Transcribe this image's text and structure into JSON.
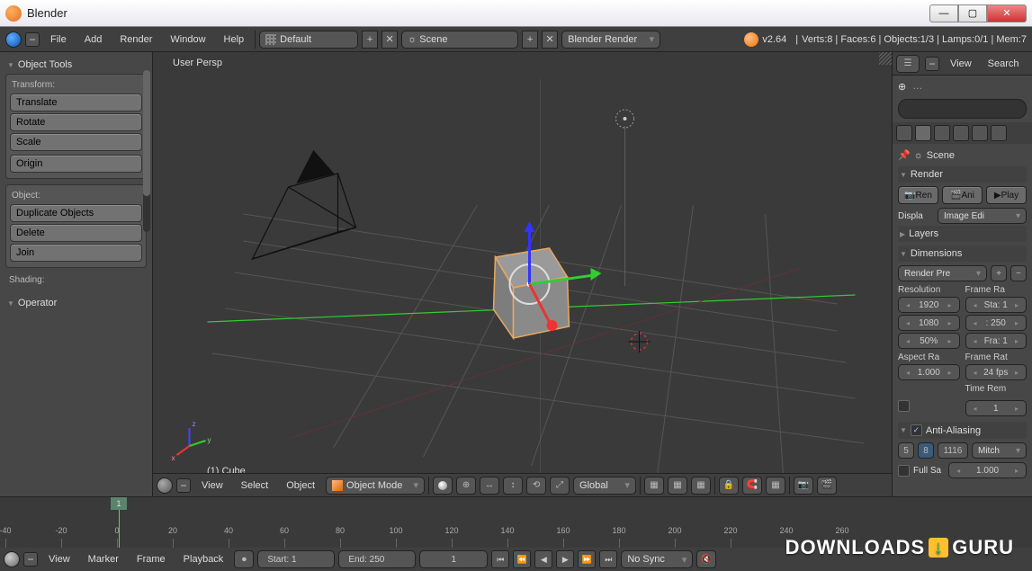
{
  "window": {
    "title": "Blender"
  },
  "topbar": {
    "menus": [
      "File",
      "Add",
      "Render",
      "Window",
      "Help"
    ],
    "layout_preset": "Default",
    "scene_name": "Scene",
    "engine": "Blender Render",
    "version": "v2.64",
    "stats": "Verts:8 | Faces:6 | Objects:1/3 | Lamps:0/1 | Mem:7"
  },
  "tools": {
    "header": "Object Tools",
    "transform_label": "Transform:",
    "translate": "Translate",
    "rotate": "Rotate",
    "scale": "Scale",
    "origin": "Origin",
    "object_label": "Object:",
    "duplicate": "Duplicate Objects",
    "delete": "Delete",
    "join": "Join",
    "shading_label": "Shading:",
    "operator": "Operator"
  },
  "viewport": {
    "persp_label": "User Persp",
    "active_object": "(1) Cube",
    "bar": {
      "view": "View",
      "select": "Select",
      "object": "Object",
      "mode": "Object Mode",
      "orientation": "Global"
    }
  },
  "outliner": {
    "view": "View",
    "search": "Search",
    "scene_name": "Scene"
  },
  "properties": {
    "render_header": "Render",
    "render_btn": "Ren",
    "anim_btn": "Ani",
    "play_btn": "Play",
    "display_label": "Displa",
    "display_value": "Image Edi",
    "layers_header": "Layers",
    "dimensions_header": "Dimensions",
    "preset": "Render Pre",
    "resolution_label": "Resolution",
    "framerange_label": "Frame Ra",
    "res_x": "1920",
    "res_y": "1080",
    "res_pct": "50%",
    "frame_start": "Sta: 1",
    "frame_end": ": 250",
    "frame_step": "Fra: 1",
    "aspect_label": "Aspect Ra",
    "framerate_label": "Frame Rat",
    "aspect_val": "1.000",
    "fps": "24 fps",
    "timeremap_label": "Time Rem",
    "timeremap_val": "1",
    "aa_header": "Anti-Aliasing",
    "aa_5": "5",
    "aa_8": "8",
    "aa_1116": "1116",
    "aa_filter": "Mitch",
    "fullsample": "Full Sa",
    "fullsample_val": "1.000"
  },
  "timeline": {
    "menus": [
      "View",
      "Marker",
      "Frame",
      "Playback"
    ],
    "start_label": "Start:",
    "start": "1",
    "end_label": "End:",
    "end": "250",
    "current": "1",
    "sync": "No Sync",
    "ticks": [
      -40,
      -20,
      0,
      20,
      40,
      60,
      80,
      100,
      120,
      140,
      160,
      180,
      200,
      220,
      240,
      260
    ]
  },
  "watermark": {
    "left": "DOWNLOADS",
    "right": "GURU"
  }
}
